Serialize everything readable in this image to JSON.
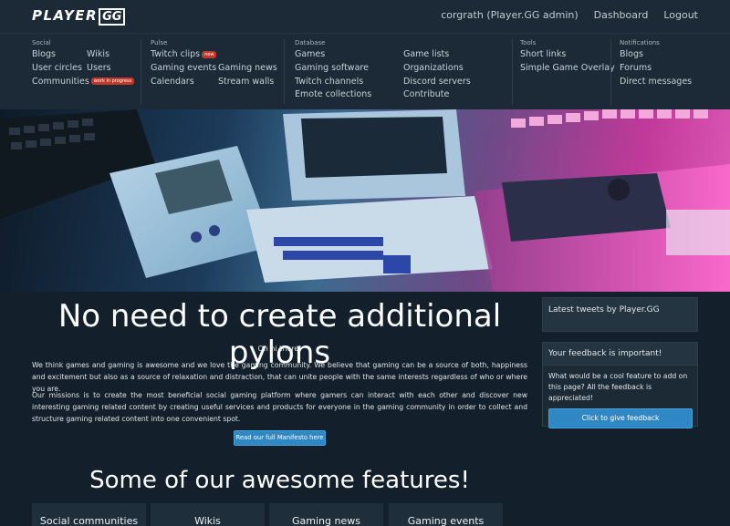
{
  "header": {
    "logo_text": "PLAYER",
    "logo_gg": "GG",
    "user": "corgrath (Player.GG admin)",
    "dashboard": "Dashboard",
    "logout": "Logout"
  },
  "menu": {
    "social": {
      "title": "Social",
      "items": [
        "Blogs",
        "Wikis",
        "User circles",
        "Users",
        "Communities"
      ],
      "badge": "work in progress"
    },
    "pulse": {
      "title": "Pulse",
      "items": [
        "Twitch clips",
        "Gaming events",
        "Gaming news",
        "Calendars",
        "Stream walls"
      ],
      "badge": "new"
    },
    "database": {
      "title": "Database",
      "items": [
        "Games",
        "Game lists",
        "Gaming software",
        "Organizations",
        "Twitch channels",
        "Discord servers",
        "Emote collections",
        "Contribute"
      ]
    },
    "tools": {
      "title": "Tools",
      "items": [
        "Short links",
        "Simple Game Overlay"
      ]
    },
    "notifications": {
      "title": "Notifications",
      "items": [
        "Blogs",
        "Forums",
        "Direct messages"
      ]
    }
  },
  "main": {
    "title": "No need to create additional pylons",
    "greeting": "Oh hi there!",
    "para1": "We think games and gaming is awesome and we love the gaming community. We believe that gaming can be a source of both, happiness and excitement but also as a source of relaxation and distraction, that can unite people with the same interests regardless of who or where you are.",
    "para2": "Our missions is to create the most beneficial social gaming platform where gamers can interact with each other and discover new interesting gaming related content by creating useful services and products for everyone in the gaming community in order to collect and structure gaming related content into one convenient spot.",
    "manifesto_button": "Read our full Manifesto here",
    "features_title": "Some of our awesome features!",
    "features": [
      "Social communities",
      "Wikis",
      "Gaming news",
      "Gaming events"
    ]
  },
  "sidebar": {
    "tweets_title": "Latest tweets by Player.GG",
    "feedback_title": "Your feedback is important!",
    "feedback_text": "What would be a cool feature to add on this page? All the feedback is appreciated!",
    "feedback_button": "Click to give feedback"
  },
  "colors": {
    "accent": "#2f88c4",
    "badge": "#c0392b",
    "background": "#13202b"
  }
}
